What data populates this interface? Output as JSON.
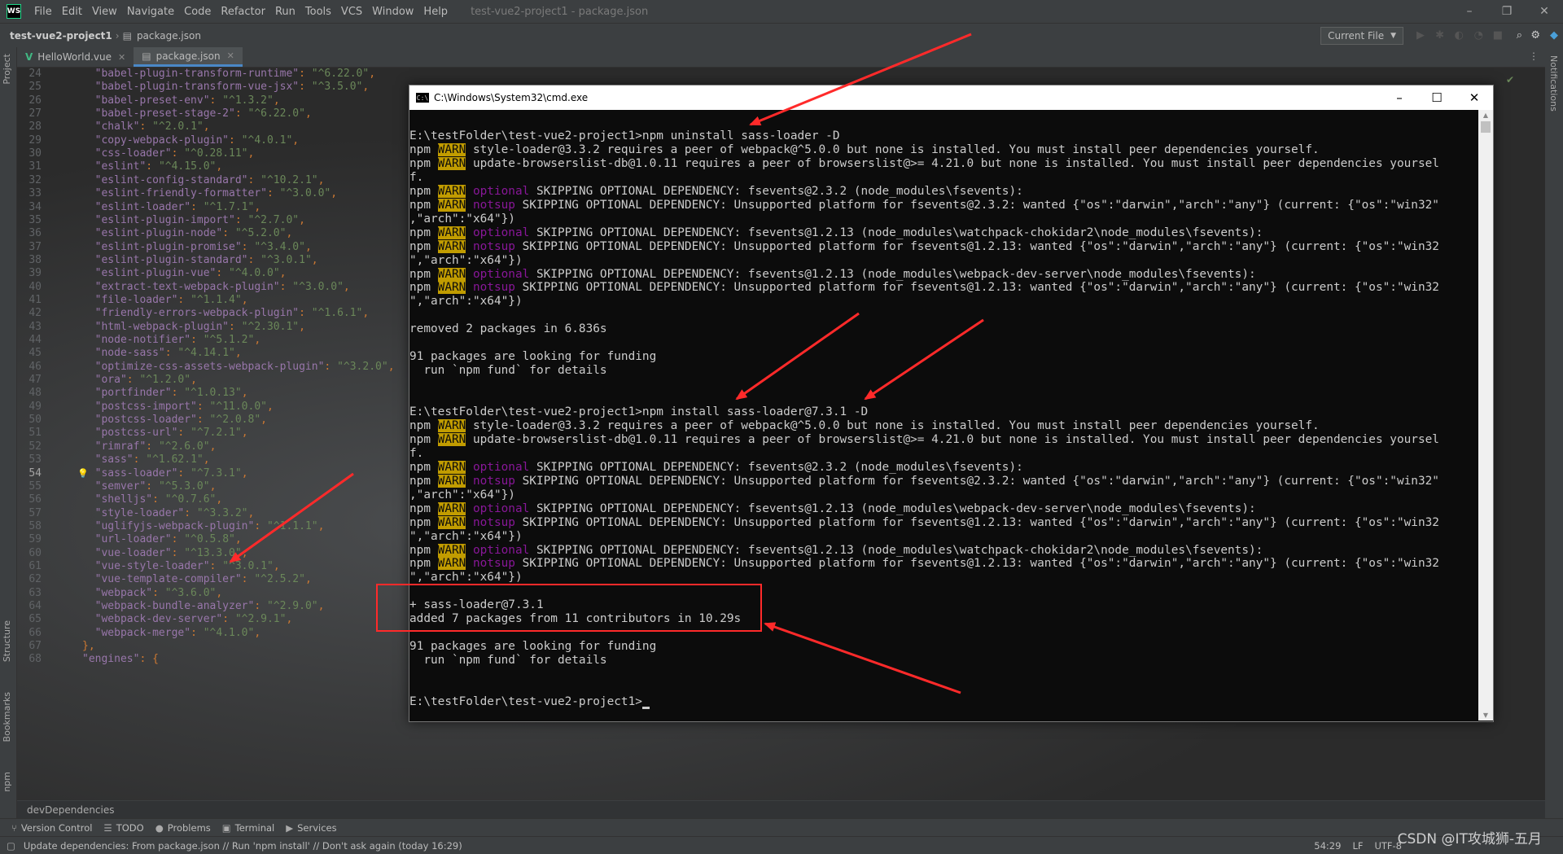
{
  "window": {
    "logo": "WS",
    "title": "test-vue2-project1 - package.json",
    "controls": {
      "minimize": "–",
      "restore": "❐",
      "close": "✕"
    }
  },
  "menu": [
    "File",
    "Edit",
    "View",
    "Navigate",
    "Code",
    "Refactor",
    "Run",
    "Tools",
    "VCS",
    "Window",
    "Help"
  ],
  "breadcrumb": {
    "project": "test-vue2-project1",
    "file": "package.json"
  },
  "toolbar": {
    "run_config": "Current File"
  },
  "left_tools": [
    "Project",
    "Structure",
    "Bookmarks",
    "npm"
  ],
  "right_tools": [
    "Notifications"
  ],
  "tabs": [
    {
      "label": "HelloWorld.vue",
      "type": "vue",
      "active": false
    },
    {
      "label": "package.json",
      "type": "json",
      "active": true
    }
  ],
  "editor": {
    "current_line": "54",
    "lines": [
      {
        "n": "24",
        "key": "\"babel-plugin-transform-runtime\"",
        "val": "\"^6.22.0\""
      },
      {
        "n": "25",
        "key": "\"babel-plugin-transform-vue-jsx\"",
        "val": "\"^3.5.0\""
      },
      {
        "n": "26",
        "key": "\"babel-preset-env\"",
        "val": "\"^1.3.2\""
      },
      {
        "n": "27",
        "key": "\"babel-preset-stage-2\"",
        "val": "\"^6.22.0\""
      },
      {
        "n": "28",
        "key": "\"chalk\"",
        "val": "\"^2.0.1\""
      },
      {
        "n": "29",
        "key": "\"copy-webpack-plugin\"",
        "val": "\"^4.0.1\""
      },
      {
        "n": "30",
        "key": "\"css-loader\"",
        "val": "\"^0.28.11\""
      },
      {
        "n": "31",
        "key": "\"eslint\"",
        "val": "\"^4.15.0\""
      },
      {
        "n": "32",
        "key": "\"eslint-config-standard\"",
        "val": "\"^10.2.1\""
      },
      {
        "n": "33",
        "key": "\"eslint-friendly-formatter\"",
        "val": "\"^3.0.0\""
      },
      {
        "n": "34",
        "key": "\"eslint-loader\"",
        "val": "\"^1.7.1\""
      },
      {
        "n": "35",
        "key": "\"eslint-plugin-import\"",
        "val": "\"^2.7.0\""
      },
      {
        "n": "36",
        "key": "\"eslint-plugin-node\"",
        "val": "\"^5.2.0\""
      },
      {
        "n": "37",
        "key": "\"eslint-plugin-promise\"",
        "val": "\"^3.4.0\""
      },
      {
        "n": "38",
        "key": "\"eslint-plugin-standard\"",
        "val": "\"^3.0.1\""
      },
      {
        "n": "39",
        "key": "\"eslint-plugin-vue\"",
        "val": "\"^4.0.0\""
      },
      {
        "n": "40",
        "key": "\"extract-text-webpack-plugin\"",
        "val": "\"^3.0.0\""
      },
      {
        "n": "41",
        "key": "\"file-loader\"",
        "val": "\"^1.1.4\""
      },
      {
        "n": "42",
        "key": "\"friendly-errors-webpack-plugin\"",
        "val": "\"^1.6.1\""
      },
      {
        "n": "43",
        "key": "\"html-webpack-plugin\"",
        "val": "\"^2.30.1\""
      },
      {
        "n": "44",
        "key": "\"node-notifier\"",
        "val": "\"^5.1.2\""
      },
      {
        "n": "45",
        "key": "\"node-sass\"",
        "val": "\"^4.14.1\""
      },
      {
        "n": "46",
        "key": "\"optimize-css-assets-webpack-plugin\"",
        "val": "\"^3.2.0\""
      },
      {
        "n": "47",
        "key": "\"ora\"",
        "val": "\"^1.2.0\""
      },
      {
        "n": "48",
        "key": "\"portfinder\"",
        "val": "\"^1.0.13\""
      },
      {
        "n": "49",
        "key": "\"postcss-import\"",
        "val": "\"^11.0.0\""
      },
      {
        "n": "50",
        "key": "\"postcss-loader\"",
        "val": "\"^2.0.8\""
      },
      {
        "n": "51",
        "key": "\"postcss-url\"",
        "val": "\"^7.2.1\""
      },
      {
        "n": "52",
        "key": "\"rimraf\"",
        "val": "\"^2.6.0\""
      },
      {
        "n": "53",
        "key": "\"sass\"",
        "val": "\"^1.62.1\""
      },
      {
        "n": "54",
        "key": "\"sass-loader\"",
        "val": "\"^7.3.1\""
      },
      {
        "n": "55",
        "key": "\"semver\"",
        "val": "\"^5.3.0\""
      },
      {
        "n": "56",
        "key": "\"shelljs\"",
        "val": "\"^0.7.6\""
      },
      {
        "n": "57",
        "key": "\"style-loader\"",
        "val": "\"^3.3.2\""
      },
      {
        "n": "58",
        "key": "\"uglifyjs-webpack-plugin\"",
        "val": "\"^1.1.1\""
      },
      {
        "n": "59",
        "key": "\"url-loader\"",
        "val": "\"^0.5.8\""
      },
      {
        "n": "60",
        "key": "\"vue-loader\"",
        "val": "\"^13.3.0\""
      },
      {
        "n": "61",
        "key": "\"vue-style-loader\"",
        "val": "\"^3.0.1\""
      },
      {
        "n": "62",
        "key": "\"vue-template-compiler\"",
        "val": "\"^2.5.2\""
      },
      {
        "n": "63",
        "key": "\"webpack\"",
        "val": "\"^3.6.0\""
      },
      {
        "n": "64",
        "key": "\"webpack-bundle-analyzer\"",
        "val": "\"^2.9.0\""
      },
      {
        "n": "65",
        "key": "\"webpack-dev-server\"",
        "val": "\"^2.9.1\""
      },
      {
        "n": "66",
        "key": "\"webpack-merge\"",
        "val": "\"^4.1.0\""
      }
    ],
    "line67": {
      "n": "67",
      "text": "},"
    },
    "line68": {
      "n": "68",
      "key": "\"engines\"",
      "text": ": {"
    }
  },
  "editor_breadcrumb": "devDependencies",
  "cmd": {
    "title": "C:\\Windows\\System32\\cmd.exe",
    "icon_text": "C:\\",
    "controls": {
      "minimize": "–",
      "maximize": "☐",
      "close": "✕"
    },
    "lines": [
      {
        "p": [
          {
            "t": "E:\\testFolder\\test-vue2-project1>npm uninstall sass-loader -D"
          }
        ]
      },
      {
        "p": [
          {
            "t": "npm "
          },
          {
            "t": "WARN",
            "c": "warn"
          },
          {
            "t": " style-loader@3.3.2 requires a peer of webpack@^5.0.0 but none is installed. You must install peer dependencies yourself."
          }
        ]
      },
      {
        "p": [
          {
            "t": "npm "
          },
          {
            "t": "WARN",
            "c": "warn"
          },
          {
            "t": " update-browserslist-db@1.0.11 requires a peer of browserslist@>= 4.21.0 but none is installed. You must install peer dependencies yoursel"
          }
        ]
      },
      {
        "p": [
          {
            "t": "f."
          }
        ]
      },
      {
        "p": [
          {
            "t": "npm "
          },
          {
            "t": "WARN",
            "c": "warn"
          },
          {
            "t": " "
          },
          {
            "t": "optional",
            "c": "mag"
          },
          {
            "t": " SKIPPING OPTIONAL DEPENDENCY: fsevents@2.3.2 (node_modules\\fsevents):"
          }
        ]
      },
      {
        "p": [
          {
            "t": "npm "
          },
          {
            "t": "WARN",
            "c": "warn"
          },
          {
            "t": " "
          },
          {
            "t": "notsup",
            "c": "mag"
          },
          {
            "t": " SKIPPING OPTIONAL DEPENDENCY: Unsupported platform for fsevents@2.3.2: wanted {\"os\":\"darwin\",\"arch\":\"any\"} (current: {\"os\":\"win32\""
          }
        ]
      },
      {
        "p": [
          {
            "t": ",\"arch\":\"x64\"})"
          }
        ]
      },
      {
        "p": [
          {
            "t": "npm "
          },
          {
            "t": "WARN",
            "c": "warn"
          },
          {
            "t": " "
          },
          {
            "t": "optional",
            "c": "mag"
          },
          {
            "t": " SKIPPING OPTIONAL DEPENDENCY: fsevents@1.2.13 (node_modules\\watchpack-chokidar2\\node_modules\\fsevents):"
          }
        ]
      },
      {
        "p": [
          {
            "t": "npm "
          },
          {
            "t": "WARN",
            "c": "warn"
          },
          {
            "t": " "
          },
          {
            "t": "notsup",
            "c": "mag"
          },
          {
            "t": " SKIPPING OPTIONAL DEPENDENCY: Unsupported platform for fsevents@1.2.13: wanted {\"os\":\"darwin\",\"arch\":\"any\"} (current: {\"os\":\"win32"
          }
        ]
      },
      {
        "p": [
          {
            "t": "\",\"arch\":\"x64\"})"
          }
        ]
      },
      {
        "p": [
          {
            "t": "npm "
          },
          {
            "t": "WARN",
            "c": "warn"
          },
          {
            "t": " "
          },
          {
            "t": "optional",
            "c": "mag"
          },
          {
            "t": " SKIPPING OPTIONAL DEPENDENCY: fsevents@1.2.13 (node_modules\\webpack-dev-server\\node_modules\\fsevents):"
          }
        ]
      },
      {
        "p": [
          {
            "t": "npm "
          },
          {
            "t": "WARN",
            "c": "warn"
          },
          {
            "t": " "
          },
          {
            "t": "notsup",
            "c": "mag"
          },
          {
            "t": " SKIPPING OPTIONAL DEPENDENCY: Unsupported platform for fsevents@1.2.13: wanted {\"os\":\"darwin\",\"arch\":\"any\"} (current: {\"os\":\"win32"
          }
        ]
      },
      {
        "p": [
          {
            "t": "\",\"arch\":\"x64\"})"
          }
        ]
      },
      {
        "p": [
          {
            "t": ""
          }
        ]
      },
      {
        "p": [
          {
            "t": "removed 2 packages in 6.836s"
          }
        ]
      },
      {
        "p": [
          {
            "t": ""
          }
        ]
      },
      {
        "p": [
          {
            "t": "91 packages are looking for funding"
          }
        ]
      },
      {
        "p": [
          {
            "t": "  run `npm fund` for details"
          }
        ]
      },
      {
        "p": [
          {
            "t": ""
          }
        ]
      },
      {
        "p": [
          {
            "t": ""
          }
        ]
      },
      {
        "p": [
          {
            "t": "E:\\testFolder\\test-vue2-project1>npm install sass-loader@7.3.1 -D"
          }
        ]
      },
      {
        "p": [
          {
            "t": "npm "
          },
          {
            "t": "WARN",
            "c": "warn"
          },
          {
            "t": " style-loader@3.3.2 requires a peer of webpack@^5.0.0 but none is installed. You must install peer dependencies yourself."
          }
        ]
      },
      {
        "p": [
          {
            "t": "npm "
          },
          {
            "t": "WARN",
            "c": "warn"
          },
          {
            "t": " update-browserslist-db@1.0.11 requires a peer of browserslist@>= 4.21.0 but none is installed. You must install peer dependencies yoursel"
          }
        ]
      },
      {
        "p": [
          {
            "t": "f."
          }
        ]
      },
      {
        "p": [
          {
            "t": "npm "
          },
          {
            "t": "WARN",
            "c": "warn"
          },
          {
            "t": " "
          },
          {
            "t": "optional",
            "c": "mag"
          },
          {
            "t": " SKIPPING OPTIONAL DEPENDENCY: fsevents@2.3.2 (node_modules\\fsevents):"
          }
        ]
      },
      {
        "p": [
          {
            "t": "npm "
          },
          {
            "t": "WARN",
            "c": "warn"
          },
          {
            "t": " "
          },
          {
            "t": "notsup",
            "c": "mag"
          },
          {
            "t": " SKIPPING OPTIONAL DEPENDENCY: Unsupported platform for fsevents@2.3.2: wanted {\"os\":\"darwin\",\"arch\":\"any\"} (current: {\"os\":\"win32\""
          }
        ]
      },
      {
        "p": [
          {
            "t": ",\"arch\":\"x64\"})"
          }
        ]
      },
      {
        "p": [
          {
            "t": "npm "
          },
          {
            "t": "WARN",
            "c": "warn"
          },
          {
            "t": " "
          },
          {
            "t": "optional",
            "c": "mag"
          },
          {
            "t": " SKIPPING OPTIONAL DEPENDENCY: fsevents@1.2.13 (node_modules\\webpack-dev-server\\node_modules\\fsevents):"
          }
        ]
      },
      {
        "p": [
          {
            "t": "npm "
          },
          {
            "t": "WARN",
            "c": "warn"
          },
          {
            "t": " "
          },
          {
            "t": "notsup",
            "c": "mag"
          },
          {
            "t": " SKIPPING OPTIONAL DEPENDENCY: Unsupported platform for fsevents@1.2.13: wanted {\"os\":\"darwin\",\"arch\":\"any\"} (current: {\"os\":\"win32"
          }
        ]
      },
      {
        "p": [
          {
            "t": "\",\"arch\":\"x64\"})"
          }
        ]
      },
      {
        "p": [
          {
            "t": "npm "
          },
          {
            "t": "WARN",
            "c": "warn"
          },
          {
            "t": " "
          },
          {
            "t": "optional",
            "c": "mag"
          },
          {
            "t": " SKIPPING OPTIONAL DEPENDENCY: fsevents@1.2.13 (node_modules\\watchpack-chokidar2\\node_modules\\fsevents):"
          }
        ]
      },
      {
        "p": [
          {
            "t": "npm "
          },
          {
            "t": "WARN",
            "c": "warn"
          },
          {
            "t": " "
          },
          {
            "t": "notsup",
            "c": "mag"
          },
          {
            "t": " SKIPPING OPTIONAL DEPENDENCY: Unsupported platform for fsevents@1.2.13: wanted {\"os\":\"darwin\",\"arch\":\"any\"} (current: {\"os\":\"win32"
          }
        ]
      },
      {
        "p": [
          {
            "t": "\",\"arch\":\"x64\"})"
          }
        ]
      },
      {
        "p": [
          {
            "t": ""
          }
        ]
      },
      {
        "p": [
          {
            "t": "+ sass-loader@7.3.1"
          }
        ]
      },
      {
        "p": [
          {
            "t": "added 7 packages from 11 contributors in 10.29s"
          }
        ]
      },
      {
        "p": [
          {
            "t": ""
          }
        ]
      },
      {
        "p": [
          {
            "t": "91 packages are looking for funding"
          }
        ]
      },
      {
        "p": [
          {
            "t": "  run `npm fund` for details"
          }
        ]
      },
      {
        "p": [
          {
            "t": ""
          }
        ]
      },
      {
        "p": [
          {
            "t": ""
          }
        ]
      },
      {
        "p": [
          {
            "t": "E:\\testFolder\\test-vue2-project1>"
          }
        ],
        "cursor": true
      }
    ]
  },
  "tool_windows": [
    {
      "label": "Version Control",
      "icon": "⑂"
    },
    {
      "label": "TODO",
      "icon": "☰"
    },
    {
      "label": "Problems",
      "icon": "●"
    },
    {
      "label": "Terminal",
      "icon": "▣"
    },
    {
      "label": "Services",
      "icon": "▶"
    }
  ],
  "status": {
    "message": "Update dependencies: From package.json // Run 'npm install' // Don't ask again (today 16:29)",
    "position": "54:29",
    "line_sep": "LF",
    "encoding": "UTF-8"
  },
  "watermark": "CSDN @IT攻城狮-五月",
  "colors": {
    "annotation": "#ff2a2a",
    "warn_bg": "#c19c00",
    "optional_fg": "#881798"
  }
}
